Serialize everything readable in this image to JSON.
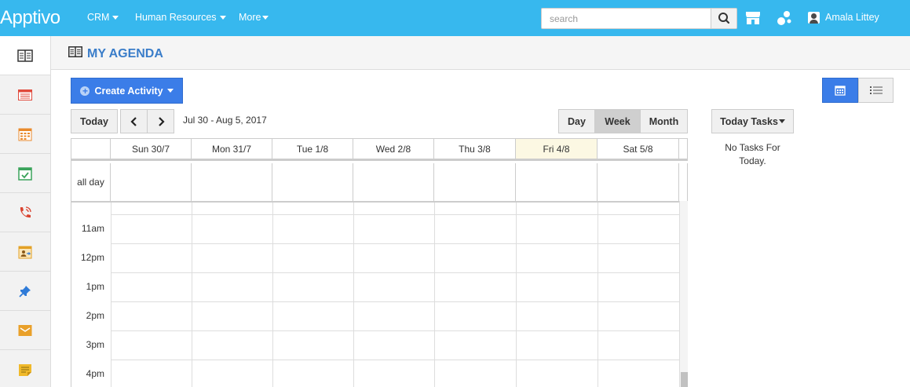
{
  "app": {
    "logo": "Apptivo"
  },
  "topnav": {
    "items": [
      {
        "label": "CRM"
      },
      {
        "label": "Human Resources"
      },
      {
        "label": "More"
      }
    ],
    "search": {
      "placeholder": "search",
      "value": ""
    },
    "user": {
      "name": "Amala Littey"
    }
  },
  "sidebar": {
    "items": [
      {
        "icon": "agenda-icon",
        "color": "#333333"
      },
      {
        "icon": "list-card-icon",
        "color": "#e04a3c"
      },
      {
        "icon": "calendar-grid-icon",
        "color": "#e98a2c"
      },
      {
        "icon": "calendar-check-icon",
        "color": "#3aa35b"
      },
      {
        "icon": "phone-call-icon",
        "color": "#d9432f"
      },
      {
        "icon": "calendar-user-icon",
        "color": "#e3a127"
      },
      {
        "icon": "pin-icon",
        "color": "#2f7bd8"
      },
      {
        "icon": "mail-icon",
        "color": "#e9a02a"
      },
      {
        "icon": "note-icon",
        "color": "#f0b92a"
      }
    ]
  },
  "page": {
    "title": "MY AGENDA"
  },
  "toolbar": {
    "create_label": "Create Activity",
    "today_label": "Today",
    "date_range": "Jul 30 - Aug 5, 2017",
    "views": {
      "day": "Day",
      "week": "Week",
      "month": "Month",
      "selected": "Week"
    }
  },
  "calendar": {
    "days": [
      "Sun 30/7",
      "Mon 31/7",
      "Tue 1/8",
      "Wed 2/8",
      "Thu 3/8",
      "Fri 4/8",
      "Sat 5/8"
    ],
    "today_index": 5,
    "allday_label": "all day",
    "times": [
      "11am",
      "12pm",
      "1pm",
      "2pm",
      "3pm",
      "4pm"
    ]
  },
  "tasks": {
    "dropdown_label": "Today Tasks",
    "empty_line1": "No Tasks For",
    "empty_line2": "Today."
  },
  "colors": {
    "topbar": "#37b8ee",
    "accent": "#3b7de8",
    "title": "#3a7dc9",
    "today": "#fcf8e3"
  }
}
